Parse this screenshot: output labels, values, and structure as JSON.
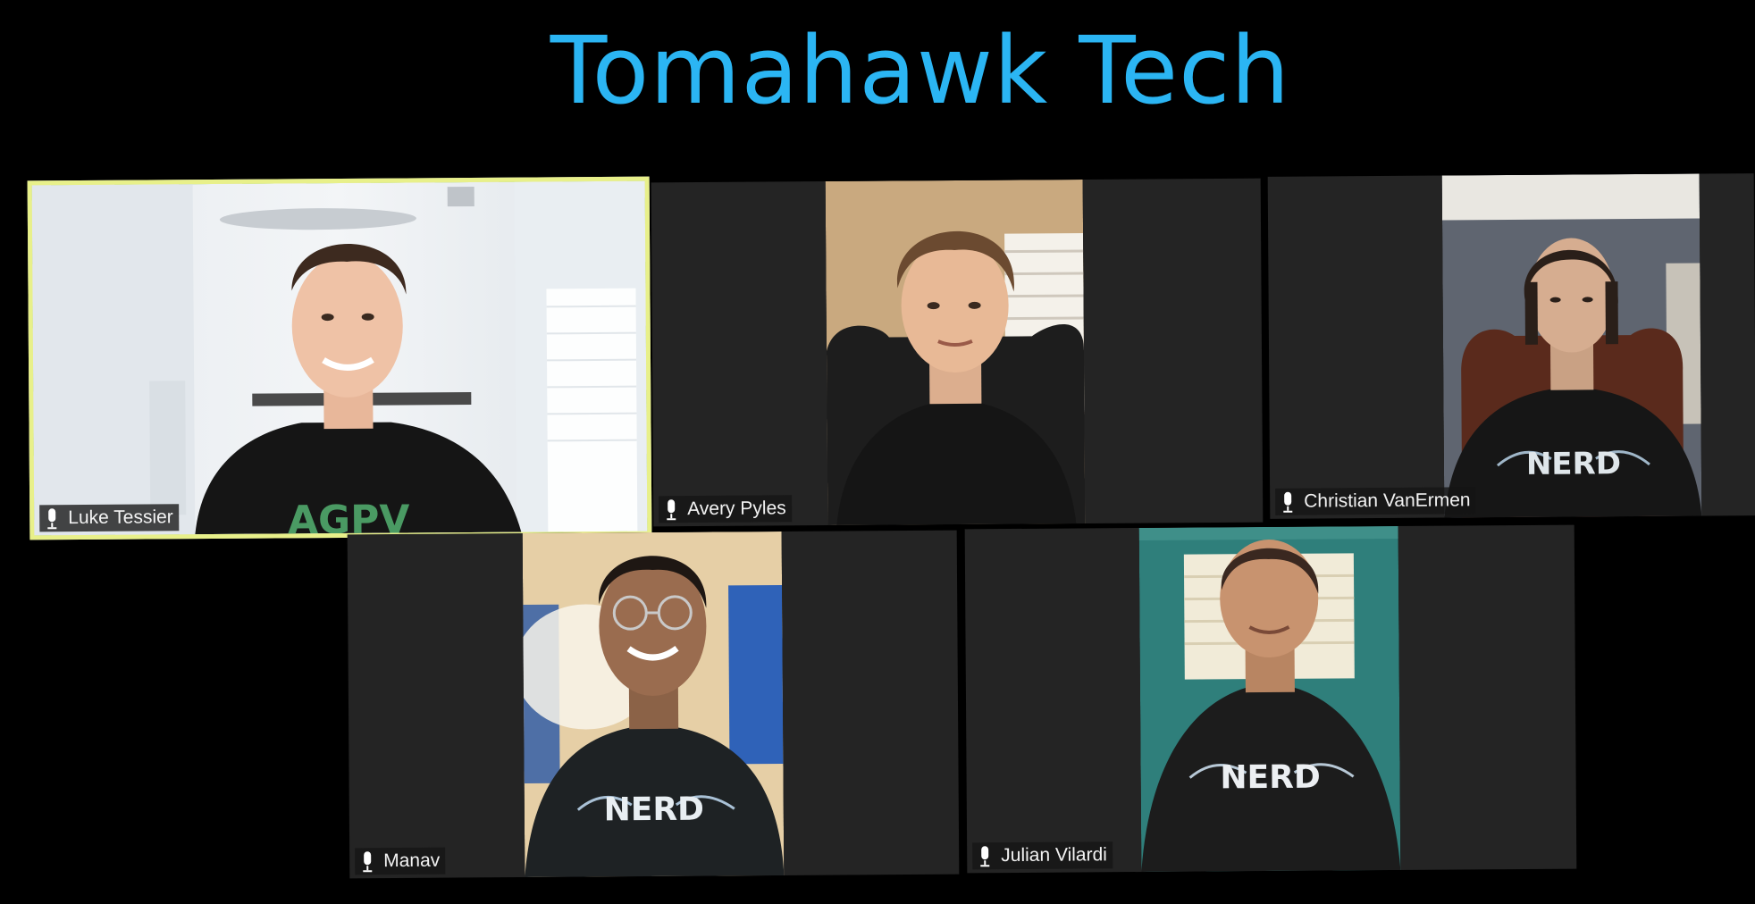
{
  "title": "Tomahawk Tech",
  "participants": [
    {
      "name": "Luke Tessier",
      "active": true,
      "shirt_text": "AGPV"
    },
    {
      "name": "Avery Pyles",
      "active": false,
      "shirt_text": ""
    },
    {
      "name": "Christian VanErmen",
      "active": false,
      "shirt_text": "NERD"
    },
    {
      "name": "Manav",
      "active": false,
      "shirt_text": "NERD"
    },
    {
      "name": "Julian Vilardi",
      "active": false,
      "shirt_text": "NERD"
    }
  ],
  "icons": {
    "mic": "microphone-icon"
  },
  "colors": {
    "title": "#2bb5f3",
    "tile_bg": "#242424",
    "active_border": "#e8f08a"
  }
}
